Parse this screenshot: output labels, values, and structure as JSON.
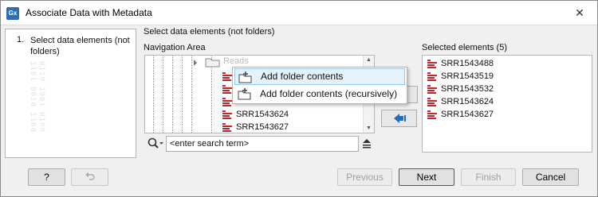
{
  "window": {
    "title": "Associate Data with Metadata",
    "app_icon_text": "Gx",
    "close_glyph": "✕"
  },
  "steps": [
    {
      "number": "1.",
      "label": "Select data elements (not folders)"
    }
  ],
  "watermark": "0110 1001 0100 1101 0010 1100",
  "main": {
    "section_label": "Select data elements (not folders)",
    "navigation_label": "Navigation Area",
    "selected_label": "Selected elements (5)",
    "folder_label": "Reads",
    "nav_items": [
      "SRR1543624",
      "SRR1543627"
    ],
    "selected_items": [
      "SRR1543488",
      "SRR1543519",
      "SRR1543532",
      "SRR1543624",
      "SRR1543627"
    ]
  },
  "context_menu": {
    "items": [
      "Add folder contents",
      "Add folder contents (recursively)"
    ]
  },
  "search": {
    "placeholder": "<enter search term>",
    "value": "<enter search term>"
  },
  "footer": {
    "help_label": "?",
    "previous_label": "Previous",
    "next_label": "Next",
    "finish_label": "Finish",
    "cancel_label": "Cancel"
  },
  "colors": {
    "accent": "#2c6fb5",
    "sequence_icon": "#c0272d",
    "menu_hover": "#e5f1fb"
  },
  "icons": [
    "folder-icon",
    "sequence-list-icon",
    "folder-add-icon",
    "move-left-icon",
    "search-icon",
    "help-icon",
    "undo-icon",
    "close-icon"
  ]
}
